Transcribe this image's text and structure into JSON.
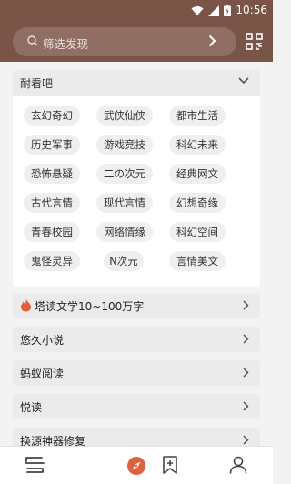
{
  "status": {
    "time": "10:56"
  },
  "search": {
    "placeholder": "筛选发现"
  },
  "group": {
    "title": "耐看吧"
  },
  "chips": [
    "玄幻奇幻",
    "武侠仙侠",
    "都市生活",
    "历史军事",
    "游戏竞技",
    "科幻未来",
    "恐怖悬疑",
    "二の次元",
    "经典网文",
    "古代言情",
    "现代言情",
    "幻想奇缘",
    "青春校园",
    "网络情缘",
    "科幻空间",
    "鬼怪灵异",
    "N次元",
    "言情美文"
  ],
  "rows": [
    "塔读文学10~100万字",
    "悠久小说",
    "蚂蚁阅读",
    "悦读",
    "换源神器修复"
  ],
  "colors": {
    "brand": "#7a5447",
    "accent": "#e0603d"
  },
  "nav": [
    "bookshelf-icon",
    "explore-icon",
    "bookmark-add-icon",
    "profile-icon"
  ]
}
